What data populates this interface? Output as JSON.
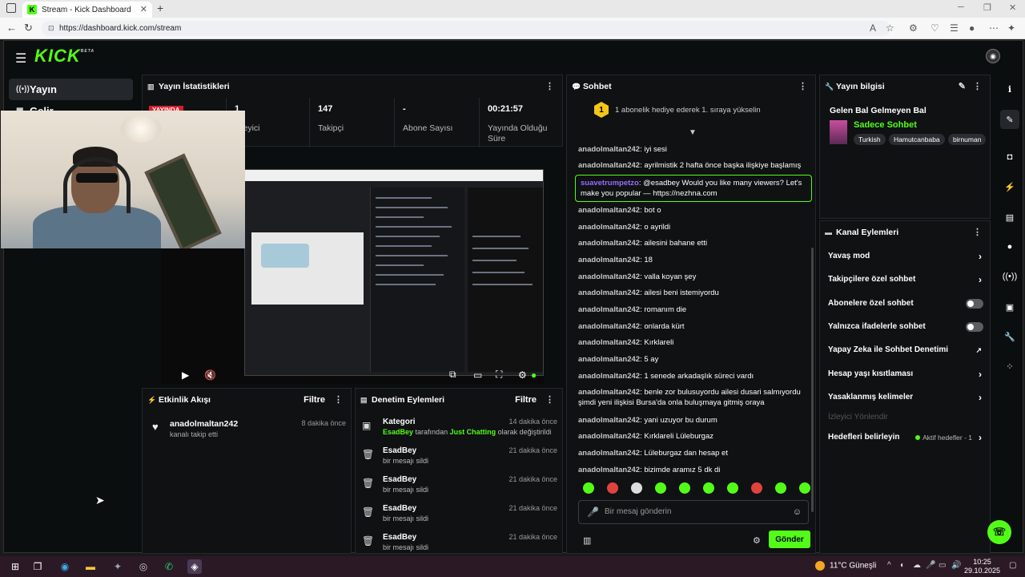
{
  "browser": {
    "tab_title": "Stream - Kick Dashboard",
    "url": "https://dashboard.kick.com/stream"
  },
  "app": {
    "logo": "KICK",
    "logo_badge": "BETA"
  },
  "sidebar": {
    "items": [
      {
        "label": "Yayın"
      },
      {
        "label": "Gelir"
      }
    ]
  },
  "stats": {
    "title": "Yayın İstatistikleri",
    "live_badge": "YAYINDA",
    "items": [
      {
        "value": "1",
        "label": "İzleyici"
      },
      {
        "value": "147",
        "label": "Takipçi"
      },
      {
        "value": "-",
        "label": "Abone Sayısı"
      },
      {
        "value": "00:21:57",
        "label": "Yayında Olduğu Süre"
      }
    ]
  },
  "activity": {
    "title": "Etkinlik Akışı",
    "filter": "Filtre",
    "items": [
      {
        "user": "anadolmaltan242",
        "text": "kanalı takip etti",
        "time": "8 dakika önce"
      }
    ]
  },
  "moderation": {
    "title": "Denetim Eylemleri",
    "filter": "Filtre",
    "items": [
      {
        "title": "Kategori",
        "actor": "EsadBey",
        "mid": "tarafından",
        "target": "Just Chatting",
        "end": "olarak değiştirildi",
        "time": "14 dakika önce"
      },
      {
        "title": "EsadBey",
        "sub": "bir mesajı sildi",
        "time": "21 dakika önce"
      },
      {
        "title": "EsadBey",
        "sub": "bir mesajı sildi",
        "time": "21 dakika önce"
      },
      {
        "title": "EsadBey",
        "sub": "bir mesajı sildi",
        "time": "21 dakika önce"
      },
      {
        "title": "EsadBey",
        "sub": "bir mesajı sildi",
        "time": "21 dakika önce"
      }
    ]
  },
  "chat": {
    "title": "Sohbet",
    "gift_banner": "1 abonelik hediye ederek 1. sıraya yükselin",
    "gift_count": "1",
    "messages": [
      {
        "user": "anadolmaltan242",
        "text": "iyi sesi"
      },
      {
        "user": "anadolmaltan242",
        "text": "ayrilmistik 2 hafta önce başka ilişkiye başlamış"
      },
      {
        "user": "suavetrumpetzo",
        "text": "@esadbey Would you like many viewers? Let's make you popular — https://nezhna.com"
      },
      {
        "user": "anadolmaltan242",
        "text": "bot o"
      },
      {
        "user": "anadolmaltan242",
        "text": "o ayrildi"
      },
      {
        "user": "anadolmaltan242",
        "text": "ailesini bahane etti"
      },
      {
        "user": "anadolmaltan242",
        "text": "18"
      },
      {
        "user": "anadolmaltan242",
        "text": "valla koyan şey"
      },
      {
        "user": "anadolmaltan242",
        "text": "ailesi beni istemiyordu"
      },
      {
        "user": "anadolmaltan242",
        "text": "romanım die"
      },
      {
        "user": "anadolmaltan242",
        "text": "onlarda kürt"
      },
      {
        "user": "anadolmaltan242",
        "text": "Kırklareli"
      },
      {
        "user": "anadolmaltan242",
        "text": "5 ay"
      },
      {
        "user": "anadolmaltan242",
        "text": "1 senede arkadaşlık süreci vardı"
      },
      {
        "user": "anadolmaltan242",
        "text": "benle zor bulusuyordu ailesi dusari salmıyordu şimdi yeni ilişkisi Bursa'da onla buluşmaya gitmiş oraya"
      },
      {
        "user": "anadolmaltan242",
        "text": "yani uzuyor bu durum"
      },
      {
        "user": "anadolmaltan242",
        "text": "Kırklareli Lüleburgaz"
      },
      {
        "user": "anadolmaltan242",
        "text": "Lüleburgaz dan hesap et"
      },
      {
        "user": "anadolmaltan242",
        "text": "bizimde aramız 5 dk di"
      }
    ],
    "input_placeholder": "Bir mesaj gönderin",
    "send_label": "Gönder"
  },
  "stream_info": {
    "title": "Yayın bilgisi",
    "stream_title": "Gelen Bal Gelmeyen Bal",
    "category": "Sadece Sohbet",
    "tags": [
      "Turkish",
      "Hamutcanbaba",
      "birnuman"
    ]
  },
  "channel_actions": {
    "title": "Kanal Eylemleri",
    "items": [
      {
        "label": "Yavaş mod"
      },
      {
        "label": "Takipçilere özel sohbet"
      },
      {
        "label": "Abonelere özel sohbet"
      },
      {
        "label": "Yalnızca ifadelerle sohbet"
      },
      {
        "label": "Yapay Zeka ile Sohbet Denetimi"
      },
      {
        "label": "Hesap yaşı kısıtlaması"
      },
      {
        "label": "Yasaklanmış kelimeler"
      },
      {
        "label": "İzleyici Yönlendir"
      },
      {
        "label": "Hedefleri belirleyin",
        "note": "Aktif hedefler - 1"
      }
    ]
  },
  "taskbar": {
    "weather": "11°C Güneşli",
    "time": "10:25",
    "date": "29.10.2025"
  }
}
